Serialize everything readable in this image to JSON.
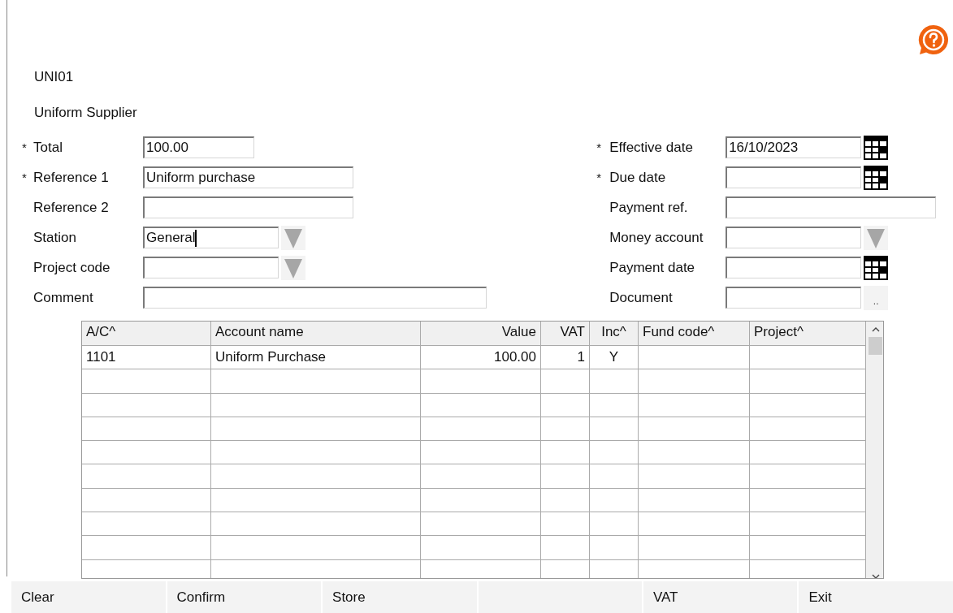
{
  "account": {
    "code": "UNI01",
    "name": "Uniform Supplier"
  },
  "left_fields": [
    {
      "label": "Total",
      "required_mark": "*",
      "kind": "short",
      "value": "100.00",
      "focused": false
    },
    {
      "label": "Reference 1",
      "required_mark": "*",
      "kind": "text",
      "value": "Uniform purchase",
      "focused": false
    },
    {
      "label": "Reference 2",
      "kind": "text",
      "focused": false
    },
    {
      "label": "Station",
      "kind": "dropdown",
      "value": "General",
      "focused": true
    },
    {
      "label": "Project code",
      "kind": "dropdown",
      "focused": false
    },
    {
      "label": "Comment",
      "kind": "long",
      "focused": false
    }
  ],
  "right_fields": [
    {
      "label": "Effective date",
      "required_mark": "*",
      "kind": "date",
      "value": "16/10/2023",
      "focused": false
    },
    {
      "label": "Due date",
      "required_mark": "*",
      "kind": "date",
      "focused": false
    },
    {
      "label": "Payment ref.",
      "kind": "text",
      "focused": false
    },
    {
      "label": "Money account",
      "kind": "dropdown",
      "focused": false
    },
    {
      "label": "Payment date",
      "kind": "date",
      "focused": false
    },
    {
      "label": "Document",
      "kind": "browse",
      "browse_label": "..",
      "focused": false
    }
  ],
  "table": {
    "columns": [
      {
        "label": "A/C^"
      },
      {
        "label": "Account name"
      },
      {
        "label": "Value"
      },
      {
        "label": "VAT"
      },
      {
        "label": "Inc^"
      },
      {
        "label": "Fund code^"
      },
      {
        "label": "Project^"
      }
    ],
    "rows": [
      {
        "cells": [
          "1101",
          "Uniform Purchase",
          "100.00",
          "1",
          "Y"
        ]
      }
    ]
  },
  "buttons": [
    {
      "kind": "button",
      "label": "Clear"
    },
    {
      "kind": "button",
      "label": "Confirm"
    },
    {
      "kind": "button",
      "label": "Store"
    },
    {
      "kind": "blank"
    },
    {
      "kind": "button",
      "label": "VAT"
    },
    {
      "kind": "button",
      "label": "Exit"
    }
  ]
}
